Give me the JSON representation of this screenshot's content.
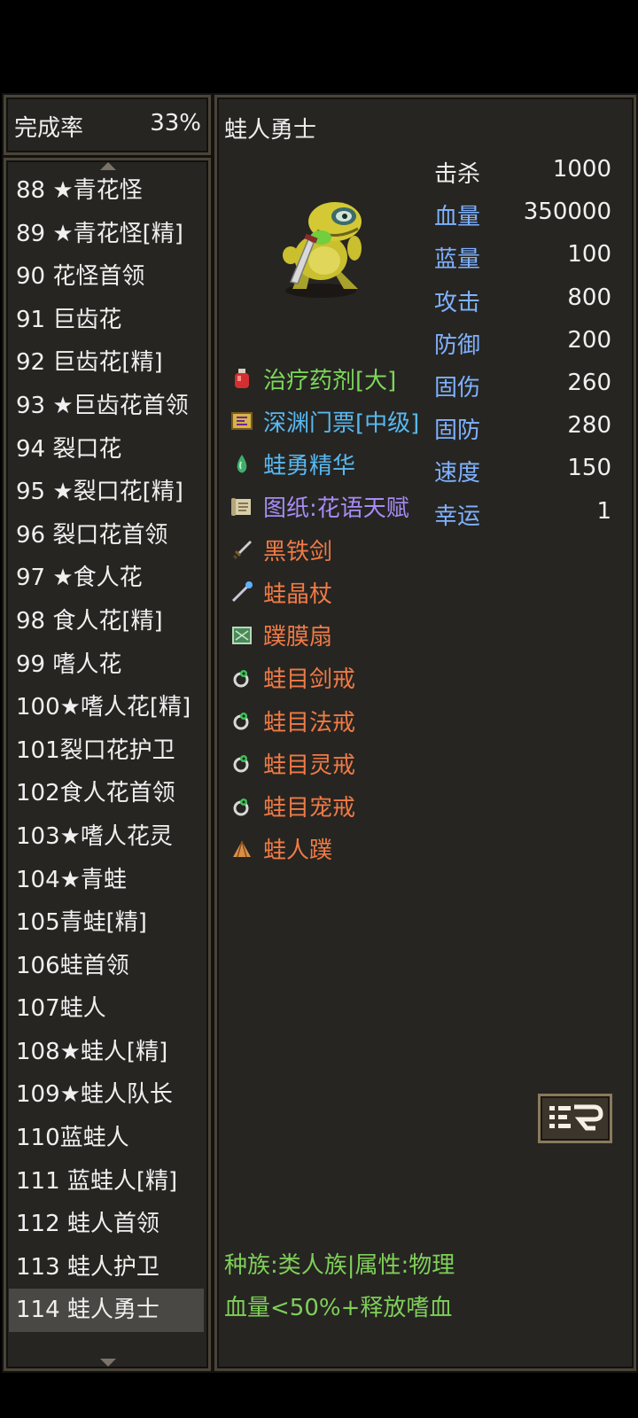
{
  "completion": {
    "label": "完成率",
    "value": "33%"
  },
  "monster_list": [
    "88 ★青花怪",
    "89 ★青花怪[精]",
    "90 花怪首领",
    "91 巨齿花",
    "92 巨齿花[精]",
    "93 ★巨齿花首领",
    "94 裂口花",
    "95 ★裂口花[精]",
    "96 裂口花首领",
    "97 ★食人花",
    "98 食人花[精]",
    "99 嗜人花",
    "100★嗜人花[精]",
    "101裂口花护卫",
    "102食人花首领",
    "103★嗜人花灵",
    "104★青蛙",
    "105青蛙[精]",
    "106蛙首领",
    "107蛙人",
    "108★蛙人[精]",
    "109★蛙人队长",
    "110蓝蛙人",
    "111 蓝蛙人[精]",
    "112 蛙人首领",
    "113 蛙人护卫",
    "114 蛙人勇士"
  ],
  "selected_index": 26,
  "detail": {
    "name": "蛙人勇士",
    "sprite_icon": "frog-warrior-sprite",
    "stats": [
      {
        "label": "击杀",
        "value": "1000",
        "color": "#eeeeee"
      },
      {
        "label": "血量",
        "value": "350000",
        "color": "#7fb2ff"
      },
      {
        "label": "蓝量",
        "value": "100",
        "color": "#7fb2ff"
      },
      {
        "label": "攻击",
        "value": "800",
        "color": "#7fb2ff"
      },
      {
        "label": "防御",
        "value": "200",
        "color": "#7fb2ff"
      },
      {
        "label": "固伤",
        "value": "260",
        "color": "#7fb2ff"
      },
      {
        "label": "固防",
        "value": "280",
        "color": "#7fb2ff"
      },
      {
        "label": "速度",
        "value": "150",
        "color": "#7fb2ff"
      },
      {
        "label": "幸运",
        "value": "1",
        "color": "#7fb2ff"
      }
    ],
    "drops": [
      {
        "name": "治疗药剂[大]",
        "color": "#7cd85a",
        "icon": "potion-icon"
      },
      {
        "name": "深渊门票[中级]",
        "color": "#58b8f0",
        "icon": "ticket-icon"
      },
      {
        "name": "蛙勇精华",
        "color": "#58b8f0",
        "icon": "essence-icon"
      },
      {
        "name": "图纸:花语天赋",
        "color": "#a78cf5",
        "icon": "scroll-icon"
      },
      {
        "name": "黑铁剑",
        "color": "#f07a45",
        "icon": "sword-icon"
      },
      {
        "name": "蛙晶杖",
        "color": "#f07a45",
        "icon": "staff-icon"
      },
      {
        "name": "蹼膜扇",
        "color": "#f07a45",
        "icon": "fan-icon"
      },
      {
        "name": "蛙目剑戒",
        "color": "#f07a45",
        "icon": "ring-icon"
      },
      {
        "name": "蛙目法戒",
        "color": "#f07a45",
        "icon": "ring-icon"
      },
      {
        "name": "蛙目灵戒",
        "color": "#f07a45",
        "icon": "ring-icon"
      },
      {
        "name": "蛙目宠戒",
        "color": "#f07a45",
        "icon": "ring-icon"
      },
      {
        "name": "蛙人蹼",
        "color": "#f07a45",
        "icon": "web-icon"
      }
    ],
    "menu_icon": "list-menu-icon",
    "info_lines": [
      "种族:类人族|属性:物理",
      "血量<50%+释放嗜血"
    ]
  }
}
